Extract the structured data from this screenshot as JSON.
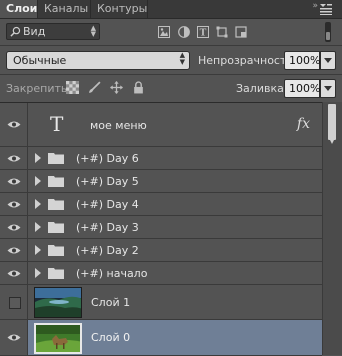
{
  "tabs": [
    {
      "label": "Слои",
      "active": true
    },
    {
      "label": "Каналы",
      "active": false
    },
    {
      "label": "Контуры",
      "active": false
    }
  ],
  "filter": {
    "label": "Вид"
  },
  "blend_mode": {
    "value": "Обычные"
  },
  "opacity": {
    "label": "Непрозрачность:",
    "value": "100%"
  },
  "lock": {
    "label": "Закрепить:"
  },
  "fill": {
    "label": "Заливка:",
    "value": "100%"
  },
  "layers": [
    {
      "name": "мое меню",
      "type": "text",
      "visible": true,
      "has_fx": true
    },
    {
      "name": "(+#) Day 6",
      "type": "group",
      "visible": true
    },
    {
      "name": "(+#) Day 5",
      "type": "group",
      "visible": true
    },
    {
      "name": "(+#) Day 4",
      "type": "group",
      "visible": true
    },
    {
      "name": "(+#) Day 3",
      "type": "group",
      "visible": true
    },
    {
      "name": "(+#) Day 2",
      "type": "group",
      "visible": true
    },
    {
      "name": "(+#) начало",
      "type": "group",
      "visible": true
    },
    {
      "name": "Слой 1",
      "type": "image",
      "visible": false
    },
    {
      "name": "Слой 0",
      "type": "image",
      "visible": true,
      "selected": true
    }
  ],
  "colors": {
    "panel": "#535353",
    "selected_row": "#6f7f96",
    "tabbar": "#393939"
  },
  "icons": {
    "text_layer": "T",
    "fx": "fx"
  }
}
